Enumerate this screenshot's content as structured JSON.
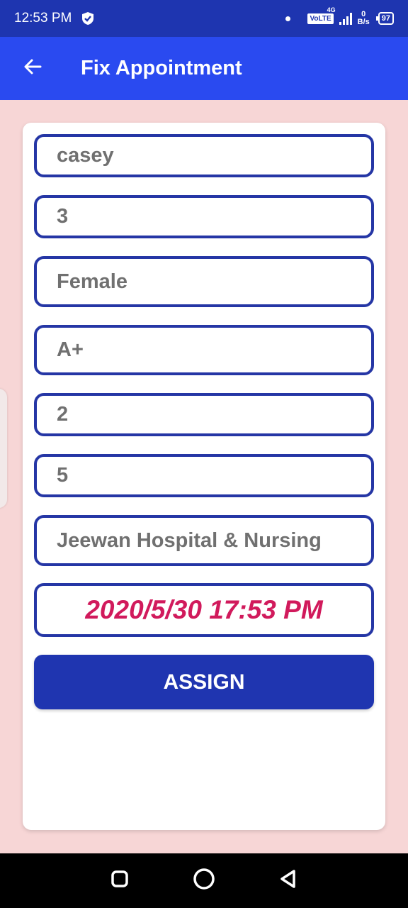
{
  "status_bar": {
    "time": "12:53 PM",
    "volte": "VoLTE",
    "network": "4G",
    "speed_value": "0",
    "speed_unit": "B/s",
    "battery": "97"
  },
  "app_bar": {
    "title": "Fix Appointment",
    "back_icon": "arrow-left-icon"
  },
  "form": {
    "name": "casey",
    "age": "3",
    "gender": "Female",
    "blood_group": "A+",
    "field_5": "2",
    "field_6": "5",
    "hospital": "Jeewan Hospital & Nursing",
    "datetime": "2020/5/30 17:53 PM",
    "assign_label": "ASSIGN"
  },
  "nav": {
    "recent_icon": "recent-apps-icon",
    "home_icon": "home-icon",
    "back_icon": "back-triangle-icon"
  },
  "colors": {
    "status_bar": "#1e35b0",
    "app_bar": "#2a4af0",
    "background": "#f7d6d6",
    "field_border": "#2536a5",
    "datetime_text": "#d11a5c",
    "button": "#1f35b0"
  }
}
